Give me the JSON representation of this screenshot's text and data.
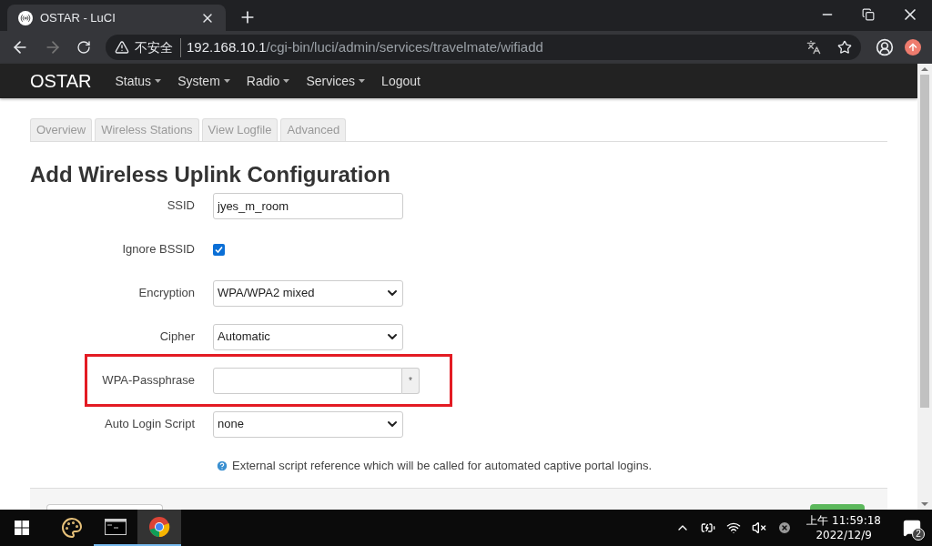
{
  "browser": {
    "tab_title": "OSTAR - LuCI",
    "security_label": "不安全",
    "url_host": "192.168.10.1",
    "url_path": "/cgi-bin/luci/admin/services/travelmate/wifiadd"
  },
  "navbar": {
    "brand": "OSTAR",
    "items": [
      {
        "label": "Status",
        "dropdown": true
      },
      {
        "label": "System",
        "dropdown": true
      },
      {
        "label": "Radio",
        "dropdown": true
      },
      {
        "label": "Services",
        "dropdown": true
      },
      {
        "label": "Logout",
        "dropdown": false
      }
    ]
  },
  "tabs": [
    {
      "label": "Overview",
      "selected": false
    },
    {
      "label": "Wireless Stations",
      "selected": false
    },
    {
      "label": "View Logfile",
      "selected": false
    },
    {
      "label": "Advanced",
      "selected": false
    }
  ],
  "heading": "Add Wireless Uplink Configuration",
  "fields": [
    {
      "kind": "text",
      "label": "SSID",
      "value": "jyes_m_room",
      "highlighted": false
    },
    {
      "kind": "checkbox",
      "label": "Ignore BSSID",
      "checked": true,
      "highlighted": false
    },
    {
      "kind": "select",
      "label": "Encryption",
      "value": "WPA/WPA2 mixed",
      "highlighted": false
    },
    {
      "kind": "select",
      "label": "Cipher",
      "value": "Automatic",
      "highlighted": false
    },
    {
      "kind": "password",
      "label": "WPA-Passphrase",
      "reveal": "*",
      "highlighted": true
    },
    {
      "kind": "select",
      "label": "Auto Login Script",
      "value": "none",
      "highlighted": false,
      "help": "External script reference which will be called for automated captive portal logins."
    }
  ],
  "taskbar": {
    "apps": [
      {
        "kind": "paint",
        "running": false,
        "active": false
      },
      {
        "kind": "terminal",
        "running": true,
        "active": false
      },
      {
        "kind": "chrome",
        "running": true,
        "active": true
      }
    ],
    "time": "上午 11:59:18",
    "date": "2022/12/9",
    "notifications": "2"
  }
}
